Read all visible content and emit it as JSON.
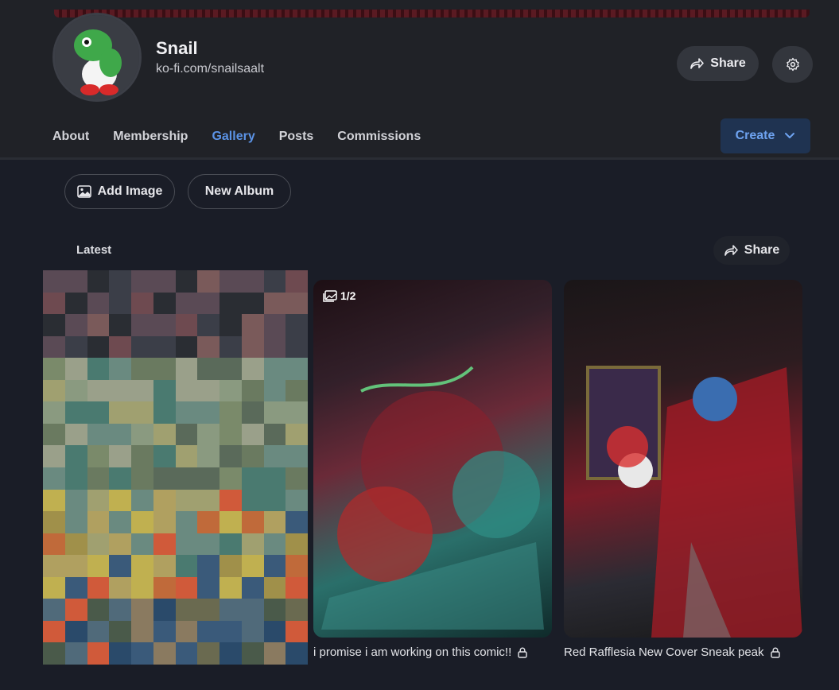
{
  "profile": {
    "name": "Snail",
    "url": "ko-fi.com/snailsaalt"
  },
  "header": {
    "share_label": "Share",
    "create_label": "Create"
  },
  "nav": {
    "tabs": [
      "About",
      "Membership",
      "Gallery",
      "Posts",
      "Commissions"
    ],
    "active": "Gallery"
  },
  "actions": {
    "add_image_label": "Add Image",
    "new_album_label": "New Album"
  },
  "gallery": {
    "section_title": "Latest",
    "share_label": "Share",
    "items": [
      {
        "caption": "i promise i am working on this comic!!",
        "locked": true,
        "image_count": "1/2"
      },
      {
        "caption": "Red Rafflesia New Cover Sneak peak",
        "locked": true
      }
    ]
  },
  "colors": {
    "accent": "#5b93e6",
    "background": "#1a1d27",
    "header_bg": "#202227"
  }
}
